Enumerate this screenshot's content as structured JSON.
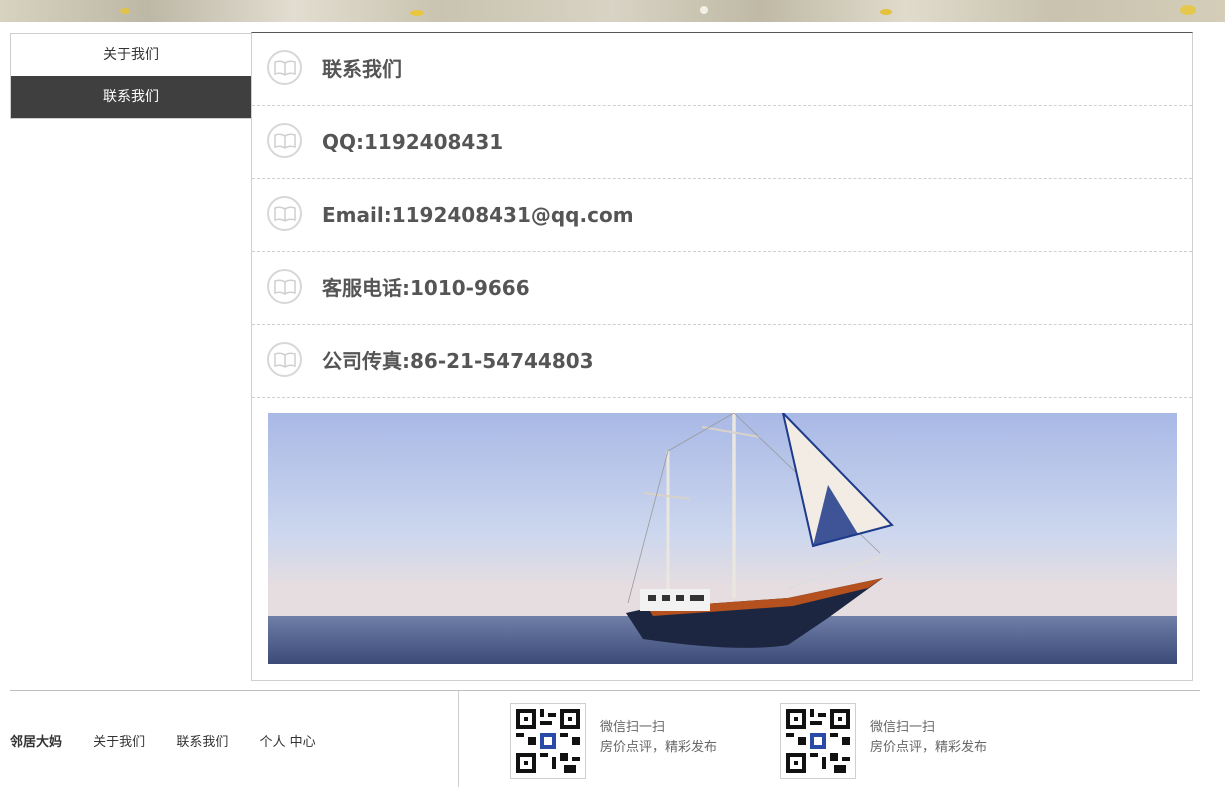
{
  "sidebar": {
    "items": [
      {
        "label": "关于我们",
        "active": false
      },
      {
        "label": "联系我们",
        "active": true
      }
    ]
  },
  "contact": {
    "title": "联系我们",
    "qq": "QQ:1192408431",
    "email": "Email:1192408431@qq.com",
    "phone": "客服电话:1010-9666",
    "fax": "公司传真:86-21-54744803",
    "icon": "book-icon"
  },
  "footer": {
    "brand": "邻居大妈",
    "links": [
      "关于我们",
      "联系我们",
      "个人 中心"
    ],
    "qr": [
      {
        "line1": "微信扫一扫",
        "line2": "房价点评，精彩发布"
      },
      {
        "line1": "微信扫一扫",
        "line2": "房价点评，精彩发布"
      }
    ]
  },
  "colors": {
    "active_bg": "#3f3f3f",
    "text_dark": "#555555",
    "border": "#cfcfcf"
  }
}
